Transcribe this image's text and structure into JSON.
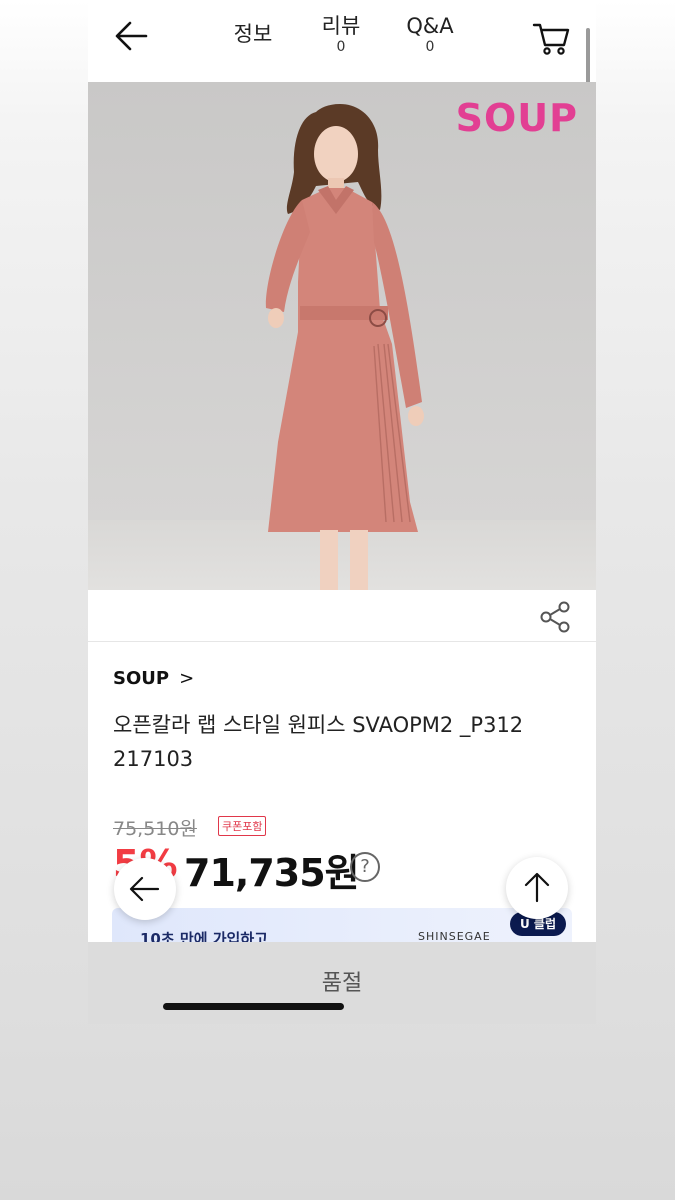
{
  "header": {
    "back_icon": "arrow-left-icon",
    "tabs": [
      {
        "label": "정보",
        "count": ""
      },
      {
        "label": "리뷰",
        "count": "0"
      },
      {
        "label": "Q&A",
        "count": "0"
      }
    ],
    "cart_icon": "cart-icon"
  },
  "hero": {
    "brand_logo": "SOUP",
    "logo_color": "#e23f93"
  },
  "product": {
    "brand": "SOUP",
    "brand_chevron": ">",
    "title": "오픈칼라 랩 스타일 원피스 SVAOPM2 _P312 217103",
    "original_price": "75,510원",
    "coupon_badge": "쿠폰포함",
    "discount": "5%",
    "price": "71,735원",
    "help_label": "?"
  },
  "promo": {
    "text": "10초 만에 가입하고",
    "brand": "SHINSEGAE",
    "badge": "U 클럽"
  },
  "bottom": {
    "status": "품절"
  },
  "colors": {
    "discount": "#f23c43",
    "coupon": "#e0374a",
    "soldout_bar": "#dcdcdc"
  }
}
